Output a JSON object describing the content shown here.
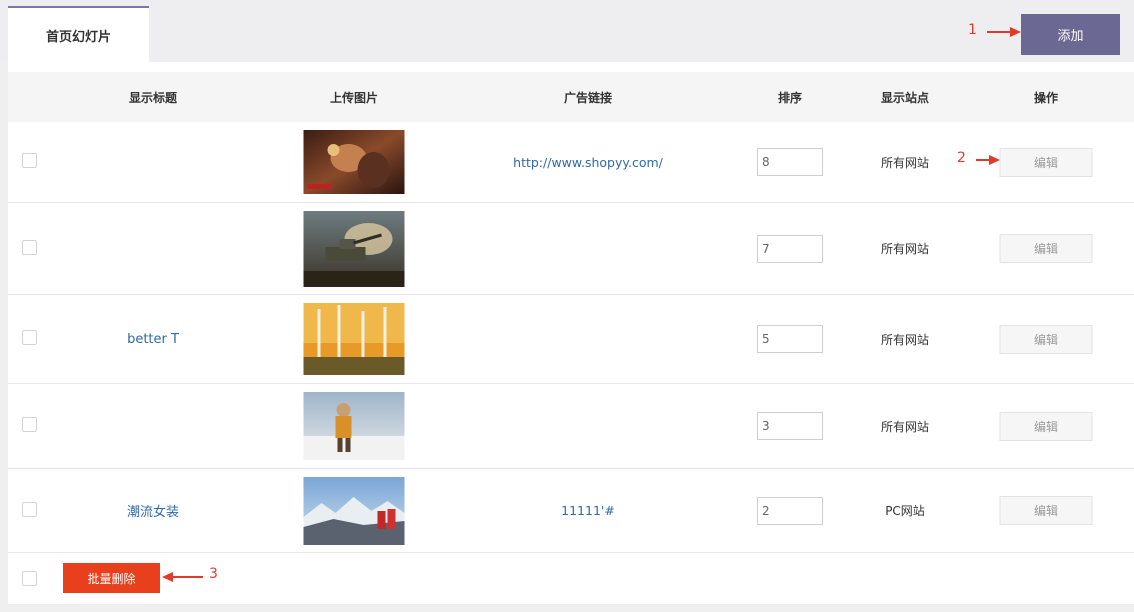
{
  "tab": {
    "label": "首页幻灯片"
  },
  "toolbar": {
    "add_label": "添加"
  },
  "columns": [
    "显示标题",
    "上传图片",
    "广告链接",
    "排序",
    "显示站点",
    "操作"
  ],
  "rows": [
    {
      "title": "",
      "image": "game-character",
      "link": "http://www.shopyy.com/",
      "sort": "8",
      "site": "所有网站",
      "edit": "编辑"
    },
    {
      "title": "",
      "image": "tank-battle",
      "link": "",
      "sort": "7",
      "site": "所有网站",
      "edit": "编辑"
    },
    {
      "title": "better T",
      "image": "autumn-birch-forest",
      "link": "",
      "sort": "5",
      "site": "所有网站",
      "edit": "编辑"
    },
    {
      "title": "",
      "image": "snow-hiker",
      "link": "",
      "sort": "3",
      "site": "所有网站",
      "edit": "编辑"
    },
    {
      "title": "潮流女装",
      "image": "mountain-hikers",
      "link": "11111'#",
      "sort": "2",
      "site": "PC网站",
      "edit": "编辑"
    }
  ],
  "footer": {
    "batch_delete_label": "批量删除"
  },
  "annotations": {
    "a1": "1",
    "a2": "2",
    "a3": "3"
  },
  "colors": {
    "accent": "#6b6894",
    "danger": "#e8401c",
    "link": "#2f6aa8",
    "annotation": "#e03a2c"
  }
}
